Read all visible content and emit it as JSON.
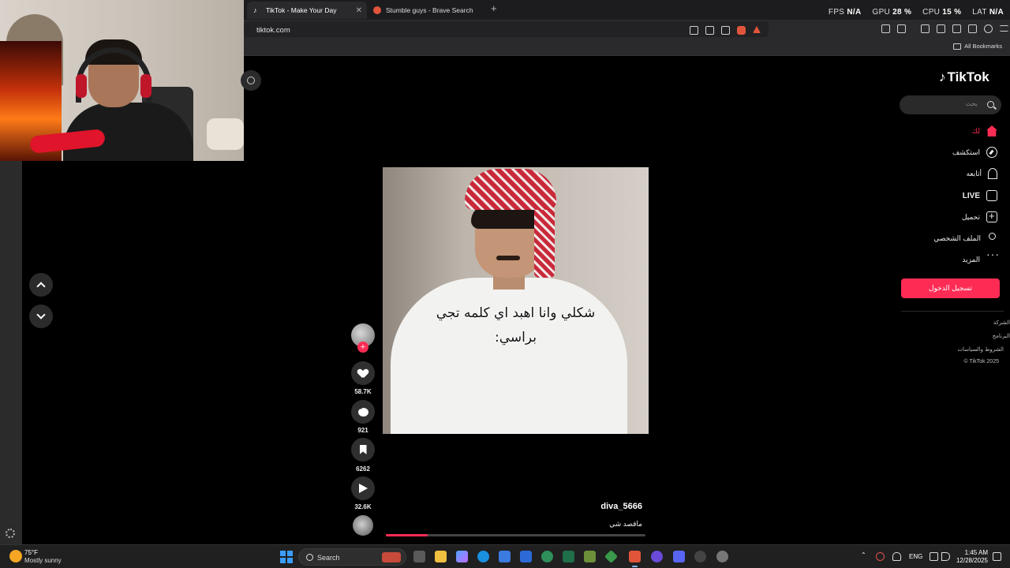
{
  "browser": {
    "tabs": [
      {
        "title": "TikTok - Make Your Day",
        "active": true
      },
      {
        "title": "Stumble guys - Brave Search",
        "active": false
      }
    ],
    "new_tab": "+",
    "url": "tiktok.com",
    "bookmarks_label": "All Bookmarks"
  },
  "perf": {
    "fps_label": "FPS",
    "fps_value": "N/A",
    "gpu_label": "GPU",
    "gpu_value": "28 %",
    "cpu_label": "CPU",
    "cpu_value": "15 %",
    "lat_label": "LAT",
    "lat_value": "N/A"
  },
  "video": {
    "caption_line1": "شكلي وانا اهبد اي كلمه تجي",
    "caption_line2": "براسي:",
    "author": "diva_5666",
    "description": "ماقصد شي",
    "progress": 0.16
  },
  "actions": {
    "likes": "58.7K",
    "comments": "921",
    "saves": "6262",
    "shares": "32.6K",
    "follow": "+"
  },
  "sidebar": {
    "logo": "TikTok",
    "search_placeholder": "بحث",
    "nav": [
      {
        "label": "لك",
        "icon": "home-icon"
      },
      {
        "label": "استكشف",
        "icon": "compass-icon"
      },
      {
        "label": "أتابعه",
        "icon": "following-icon"
      },
      {
        "label": "LIVE",
        "icon": "live-icon"
      },
      {
        "label": "تحميل",
        "icon": "upload-icon"
      },
      {
        "label": "الملف الشخصي",
        "icon": "profile-icon"
      },
      {
        "label": "المزيد",
        "icon": "more-icon"
      }
    ],
    "login": "تسجيل الدخول",
    "footer": [
      "الشركة",
      "البرنامج",
      "الشروط والسياسات",
      "© TikTok 2025"
    ]
  },
  "taskbar": {
    "weather_temp": "75°F",
    "weather_desc": "Mostly sunny",
    "search_placeholder": "Search",
    "lang": "ENG",
    "time": "1:45 AM",
    "date": "12/28/2025"
  },
  "colors": {
    "accent": "#fe2c55",
    "background": "#000000",
    "chrome": "#2a2a2d"
  }
}
